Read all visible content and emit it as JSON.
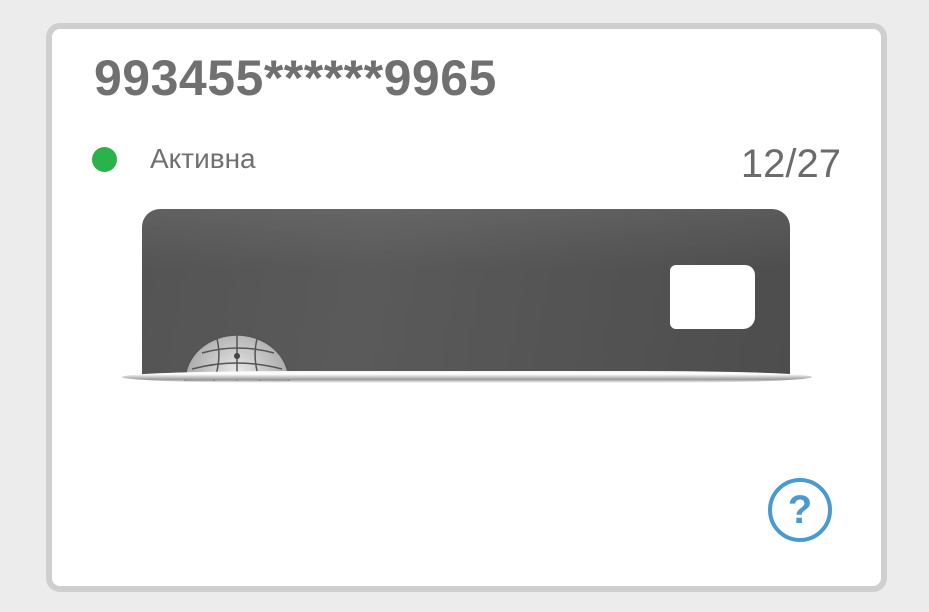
{
  "card": {
    "masked_number": "993455******9965",
    "status_label": "Активна",
    "status_color": "#2bb24c",
    "expiry": "12/27"
  },
  "icons": {
    "help": "question-mark-circle-icon",
    "status": "status-dot-icon",
    "chip": "card-chip-icon"
  },
  "help": {
    "glyph": "?",
    "color": "#4a9ad0"
  }
}
